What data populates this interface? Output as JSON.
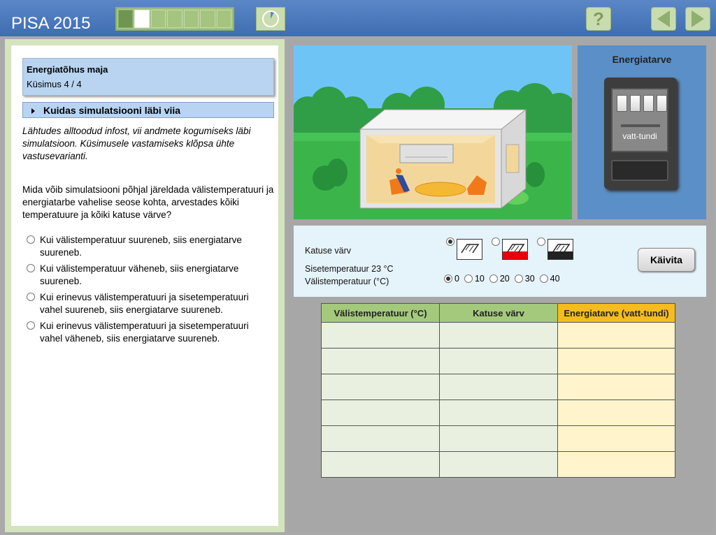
{
  "header": {
    "brand": "PISA 2015",
    "progress": {
      "total": 7,
      "done": 1,
      "current": 2
    },
    "help_label": "?"
  },
  "task": {
    "title": "Energiatõhus maja",
    "question_no": "Küsimus 4 / 4",
    "howto_label": "Kuidas simulatsiooni läbi viia",
    "intro": "Lähtudes alltoodud infost, vii andmete kogumiseks läbi simulatsioon. Küsimusele vastamiseks klõpsa ühte vastusevarianti.",
    "question": "Mida võib simulatsiooni põhjal järeldada välistemperatuuri ja energiatarbe vahelise seose kohta, arvestades kõiki temperatuure ja kõiki katuse värve?",
    "options": [
      "Kui välistemperatuur suureneb, siis energiatarve suureneb.",
      "Kui välistemperatuur väheneb, siis energiatarve suureneb.",
      "Kui erinevus välistemperatuuri ja sisetemperatuuri vahel suureneb, siis energiatarve suureneb.",
      "Kui erinevus välistemperatuuri ja sisetemperatuuri vahel väheneb, siis energiatarve suureneb."
    ]
  },
  "meter": {
    "title": "Energiatarve",
    "unit": "vatt-tundi"
  },
  "controls": {
    "roof_label": "Katuse värv",
    "inside_temp_label": "Sisetemperatuur 23 °C",
    "outside_temp_label": "Välistemperatuur (°C)",
    "roof_colors": [
      "#ffffff",
      "#e8000d",
      "#222222"
    ],
    "roof_selected": 0,
    "temps": [
      "0",
      "10",
      "20",
      "30",
      "40"
    ],
    "temp_selected": 0,
    "run_label": "Käivita"
  },
  "table": {
    "headers": [
      "Välistemperatuur (°C)",
      "Katuse värv",
      "Energiatarve (vatt-tundi)"
    ],
    "rows": 6
  },
  "colors": {
    "header_blue": "#4a7bbd",
    "panel_green": "#d4e4bd",
    "sky": "#6ec5f5",
    "grass": "#3bb54a"
  }
}
